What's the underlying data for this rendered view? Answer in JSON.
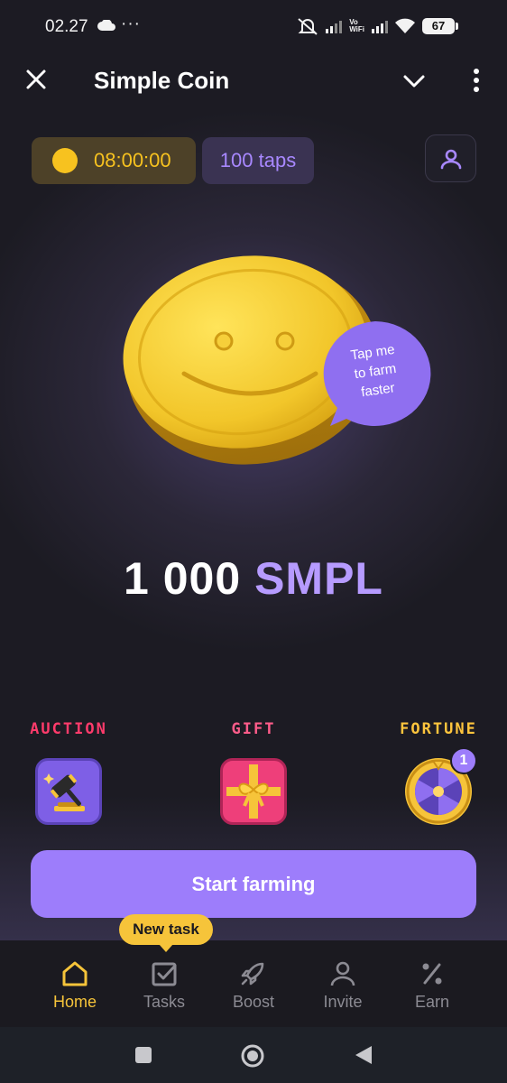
{
  "status_bar": {
    "time": "02.27",
    "dots": "···",
    "vowifi": [
      "Vo",
      "WiFi"
    ],
    "battery": "67"
  },
  "header": {
    "title": "Simple Coin"
  },
  "top_chips": {
    "timer": "08:00:00",
    "taps": "100 taps"
  },
  "coin": {
    "bubble_lines": [
      "Tap me",
      "to farm",
      "faster"
    ]
  },
  "balance": {
    "amount": "1 000",
    "unit": "SMPL"
  },
  "features": [
    {
      "label": "AUCTION",
      "color": "#ff3b6b",
      "icon": "auction-gavel-icon"
    },
    {
      "label": "GIFT",
      "color": "#ff5c8a",
      "icon": "gift-box-icon"
    },
    {
      "label": "FORTUNE",
      "color": "#ffc53d",
      "icon": "fortune-wheel-icon",
      "badge": "1"
    }
  ],
  "start_button": "Start farming",
  "bottom_nav": {
    "new_task_badge": "New task",
    "items": [
      {
        "label": "Home",
        "icon": "home-icon",
        "active": true
      },
      {
        "label": "Tasks",
        "icon": "tasks-icon"
      },
      {
        "label": "Boost",
        "icon": "rocket-icon"
      },
      {
        "label": "Invite",
        "icon": "user-icon"
      },
      {
        "label": "Earn",
        "icon": "percent-icon"
      }
    ]
  },
  "colors": {
    "accent_purple": "#9d7dfb",
    "accent_yellow": "#f6c43a",
    "background": "#1c1b23"
  }
}
